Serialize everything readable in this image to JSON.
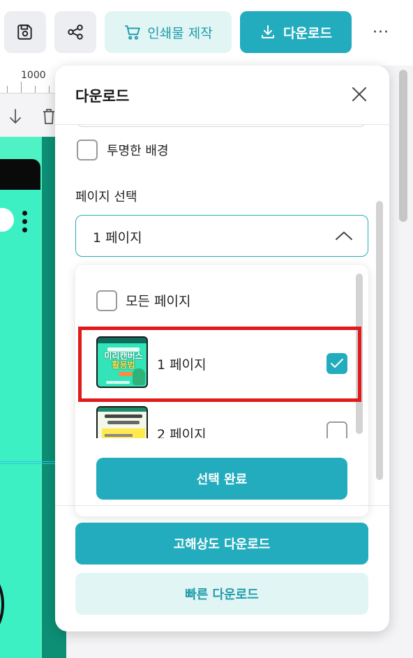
{
  "toolbar": {
    "print_label": "인쇄물 제작",
    "download_label": "다운로드",
    "more_label": "···"
  },
  "ruler": {
    "mark": "1000"
  },
  "panel": {
    "title": "다운로드",
    "transparent_bg_label": "투명한 배경",
    "page_select_label": "페이지 선택",
    "page_select_value": "1 페이지",
    "dropdown": {
      "all_pages_label": "모든 페이지",
      "pages": [
        {
          "label": "1 페이지",
          "checked": true,
          "thumb_title": [
            "미리캔버스",
            "활용법"
          ]
        },
        {
          "label": "2 페이지",
          "checked": false
        }
      ],
      "confirm_label": "선택 완료"
    },
    "hires_download_label": "고해상도 다운로드",
    "fast_download_label": "빠른 다운로드"
  },
  "colors": {
    "accent": "#22acbd",
    "accent_light": "#e2f5f5",
    "highlight": "#e01b1b",
    "canvas": "#4ef2c4"
  }
}
